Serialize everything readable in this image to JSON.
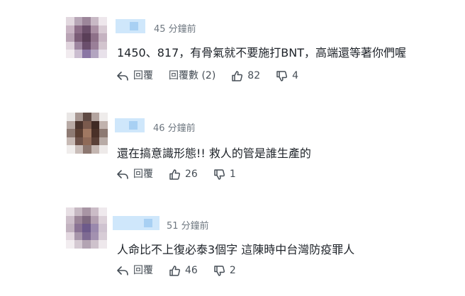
{
  "comments": [
    {
      "time": "45 分鐘前",
      "text": "1450、817，有骨氣就不要施打BNT，高端還等著你們喔",
      "reply_label": "回覆",
      "reply_count_label": "回覆數 (2)",
      "likes": "82",
      "dislikes": "4",
      "avatar_colors": [
        "#e2d8df",
        "#b7a6b6",
        "#9c869a",
        "#c8b9c5",
        "#eee7ec",
        "#c9b5c4",
        "#8c6d87",
        "#6b4f6a",
        "#a98fa3",
        "#d8cbd4",
        "#b9a4b5",
        "#7a5c76",
        "#5a3f58",
        "#8e7189",
        "#c5b3c1",
        "#e0d4dd",
        "#9e86a0",
        "#6a4e6c",
        "#9a7f98",
        "#d2c4ce",
        "#f1ebef",
        "#cbbdd0",
        "#8a76a4",
        "#b3a5c0",
        "#e8e1ea"
      ]
    },
    {
      "time": "46 分鐘前",
      "text": "還在搞意識形態!! 救人的管是誰生產的",
      "reply_label": "回覆",
      "likes": "26",
      "dislikes": "1",
      "avatar_colors": [
        "#e9e6e5",
        "#a79792",
        "#5f4a44",
        "#b3a49f",
        "#efeceb",
        "#b8aaa5",
        "#4a342d",
        "#7a5a4d",
        "#3f2a24",
        "#c1b3ae",
        "#8e7b74",
        "#5b3f33",
        "#a07862",
        "#4a3128",
        "#8d7a73",
        "#c7bab5",
        "#6d5249",
        "#8f6a58",
        "#5a4037",
        "#b8aba6",
        "#f0edec",
        "#c9bdb9",
        "#8c7770",
        "#c4b6b1",
        "#eeeae9"
      ]
    },
    {
      "time": "51 分鐘前",
      "text": "人命比不上復必泰3個字 這陳時中台灣防疫罪人",
      "reply_label": "回覆",
      "likes": "46",
      "dislikes": "2",
      "avatar_colors": [
        "#e7dfe4",
        "#c6b8c2",
        "#a895a4",
        "#cbbcc7",
        "#efe9ed",
        "#cdbfca",
        "#9b8598",
        "#7f6a80",
        "#b29fb0",
        "#dcd1d9",
        "#c2b3c0",
        "#8a7394",
        "#6d5a8a",
        "#9a89ad",
        "#cfc3d0",
        "#e3d8e0",
        "#a896ab",
        "#7e6a92",
        "#a391b0",
        "#d7ccd6",
        "#f2edf0",
        "#d4c9d2",
        "#b3a4b3",
        "#cec2cc",
        "#eee8ec"
      ]
    }
  ]
}
